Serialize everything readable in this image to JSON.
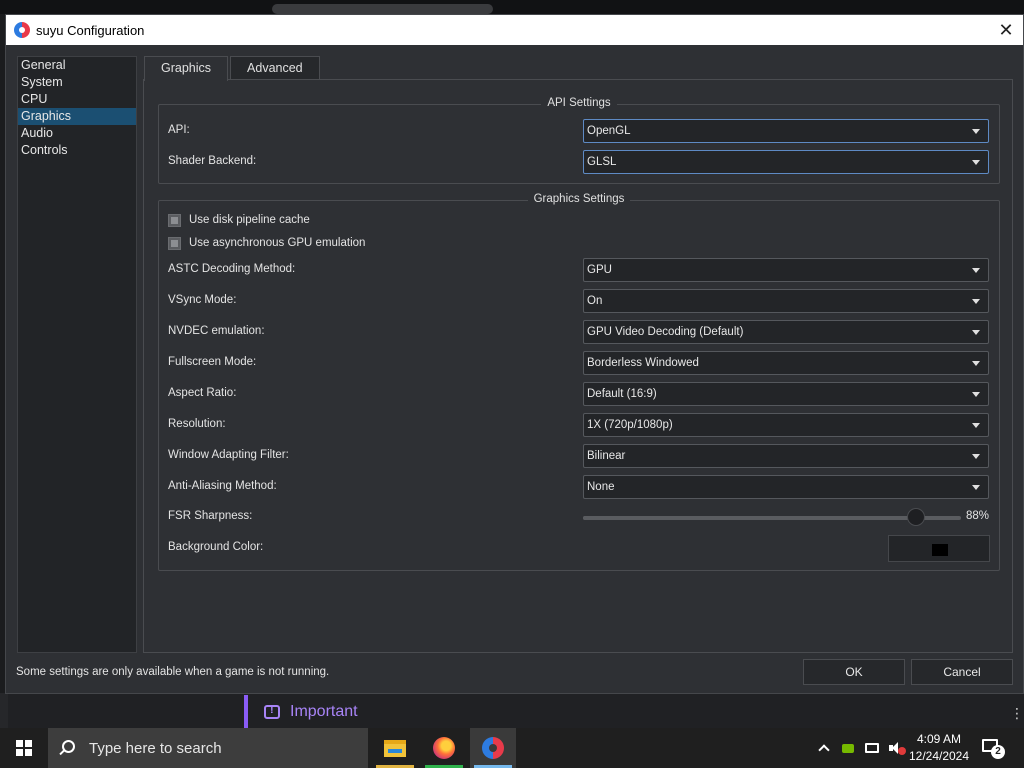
{
  "window": {
    "title": "suyu Configuration"
  },
  "sidebar": {
    "items": [
      {
        "label": "General"
      },
      {
        "label": "System"
      },
      {
        "label": "CPU"
      },
      {
        "label": "Graphics"
      },
      {
        "label": "Audio"
      },
      {
        "label": "Controls"
      }
    ],
    "selected": "Graphics"
  },
  "tabs": [
    {
      "label": "Graphics"
    },
    {
      "label": "Advanced"
    }
  ],
  "api_settings": {
    "title": "API Settings",
    "api": {
      "label": "API:",
      "value": "OpenGL"
    },
    "shader_backend": {
      "label": "Shader Backend:",
      "value": "GLSL"
    }
  },
  "graphics_settings": {
    "title": "Graphics Settings",
    "checkboxes": [
      {
        "label": "Use disk pipeline cache",
        "checked": "partial"
      },
      {
        "label": "Use asynchronous GPU emulation",
        "checked": "partial"
      }
    ],
    "combos": [
      {
        "label": "ASTC Decoding Method:",
        "value": "GPU"
      },
      {
        "label": "VSync Mode:",
        "value": "On"
      },
      {
        "label": "NVDEC emulation:",
        "value": "GPU Video Decoding (Default)"
      },
      {
        "label": "Fullscreen Mode:",
        "value": "Borderless Windowed"
      },
      {
        "label": "Aspect Ratio:",
        "value": "Default (16:9)"
      },
      {
        "label": "Resolution:",
        "value": "1X (720p/1080p)"
      },
      {
        "label": "Window Adapting Filter:",
        "value": "Bilinear"
      },
      {
        "label": "Anti-Aliasing Method:",
        "value": "None"
      }
    ],
    "fsr": {
      "label": "FSR Sharpness:",
      "value_text": "88%",
      "fraction": 0.88
    },
    "background_color": {
      "label": "Background Color:",
      "color": "#000000"
    }
  },
  "footer": {
    "note": "Some settings are only available when a game is not running.",
    "ok_label": "OK",
    "cancel_label": "Cancel"
  },
  "background": {
    "important_label": "Important"
  },
  "taskbar": {
    "search_placeholder": "Type here to search",
    "time": "4:09 AM",
    "date": "12/24/2024",
    "notification_count": "2"
  },
  "colors": {
    "selection": "#1b4f72",
    "dialog_bg": "#2e3034",
    "accent_purple": "#8a5cf6",
    "focus_border": "#5e8ac4"
  }
}
